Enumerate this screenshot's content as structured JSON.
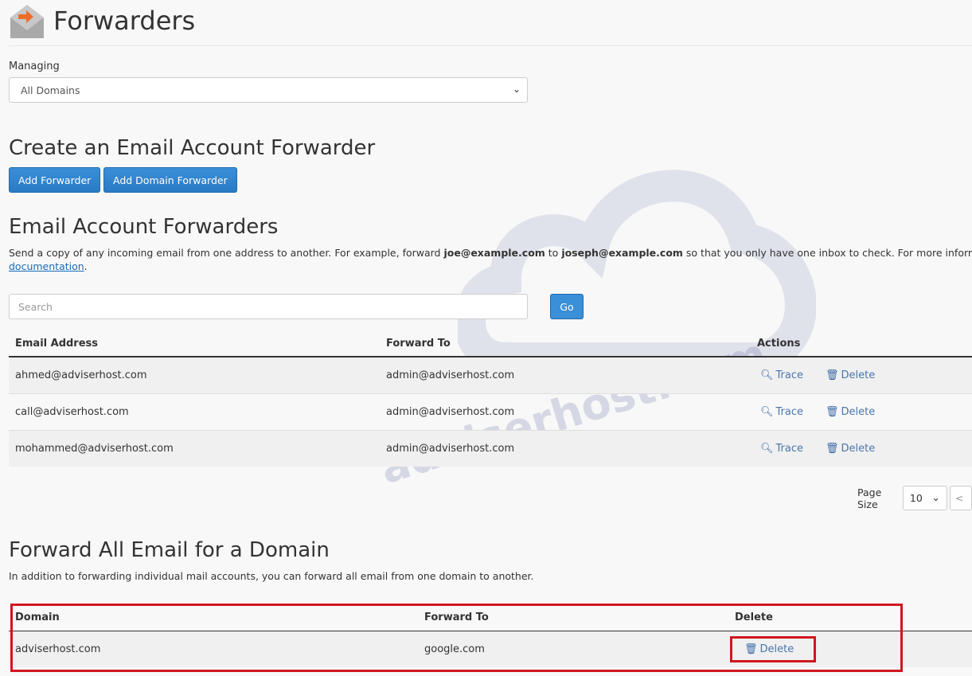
{
  "page": {
    "title": "Forwarders",
    "icon": "envelope-forward-icon"
  },
  "managing": {
    "label": "Managing",
    "value": "All Domains"
  },
  "create": {
    "heading": "Create an Email Account Forwarder",
    "add_forwarder": "Add Forwarder",
    "add_domain_forwarder": "Add Domain Forwarder"
  },
  "account_forwarders": {
    "heading": "Email Account Forwarders",
    "desc_1": "Send a copy of any incoming email from one address to another. For example, forward ",
    "desc_bold_1": "joe@example.com",
    "desc_2": " to ",
    "desc_bold_2": "joseph@example.com",
    "desc_3": " so that you only have one inbox to check. For more information,",
    "desc_link": "documentation",
    "desc_end": ".",
    "search_placeholder": "Search",
    "go": "Go",
    "columns": [
      "Email Address",
      "Forward To",
      "Actions"
    ],
    "rows": [
      {
        "email": "ahmed@adviserhost.com",
        "forward": "admin@adviserhost.com"
      },
      {
        "email": "call@adviserhost.com",
        "forward": "admin@adviserhost.com"
      },
      {
        "email": "mohammed@adviserhost.com",
        "forward": "admin@adviserhost.com"
      }
    ],
    "trace": "Trace",
    "delete": "Delete",
    "page_size_label": "Page Size",
    "page_size": "10",
    "prev": "<"
  },
  "domain_forwarders": {
    "heading": "Forward All Email for a Domain",
    "desc": "In addition to forwarding individual mail accounts, you can forward all email from one domain to another.",
    "columns": [
      "Domain",
      "Forward To",
      "Delete"
    ],
    "rows": [
      {
        "domain": "adviserhost.com",
        "forward": "google.com"
      }
    ],
    "delete": "Delete"
  },
  "watermark": "adviserhost.com",
  "colors": {
    "accent": "#2a7ac4",
    "highlight": "#d0161f",
    "link": "#4a76ad"
  }
}
